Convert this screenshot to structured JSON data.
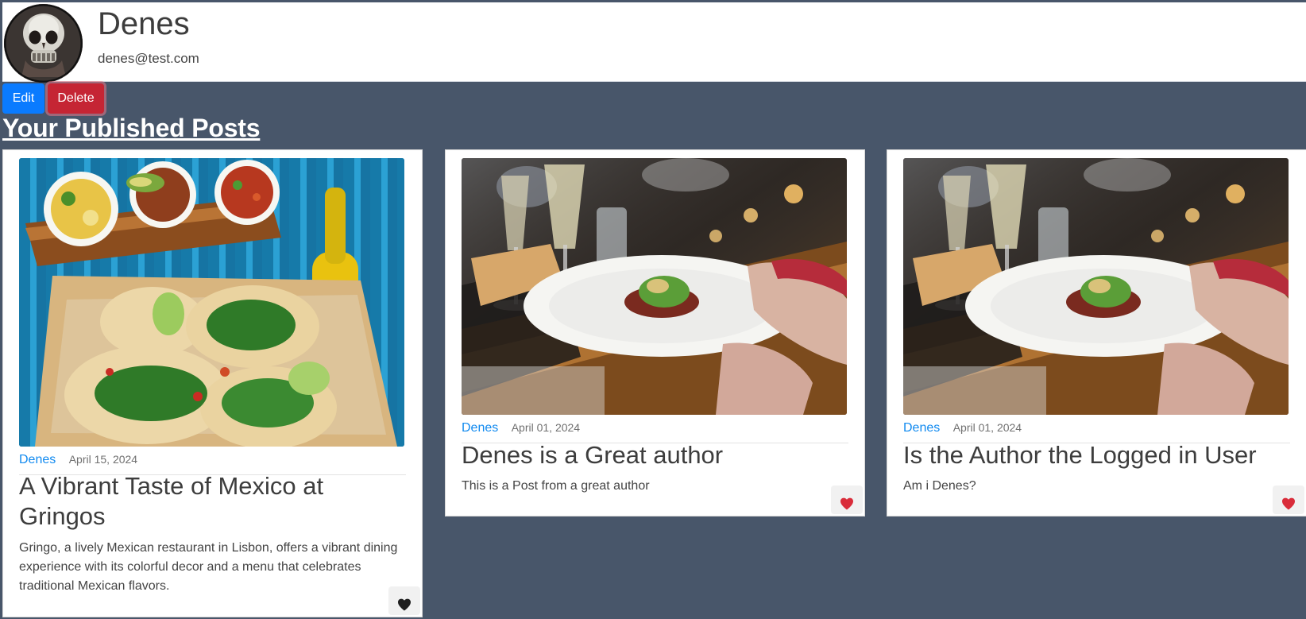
{
  "profile": {
    "name": "Denes",
    "email": "denes@test.com",
    "avatar_icon": "skull-avatar"
  },
  "actions": {
    "edit_label": "Edit",
    "delete_label": "Delete"
  },
  "section": {
    "title": "Your Published Posts"
  },
  "posts": [
    {
      "author": "Denes",
      "date": "April 15, 2024",
      "title": "A Vibrant Taste of Mexico at Gringos",
      "excerpt": "Gringo, a lively Mexican restaurant in Lisbon, offers a vibrant dining experience with its colorful decor and a menu that celebrates traditional Mexican flavors.",
      "image_desc": "tacos with salsa bowls and soda bottle",
      "liked": false,
      "like_icon": "heart-icon",
      "like_color": "#1f1f1f"
    },
    {
      "author": "Denes",
      "date": "April 01, 2024",
      "title": "Denes is a Great author",
      "excerpt": "This is a Post from a great author",
      "image_desc": "restaurant table with wine glasses and plated dish",
      "liked": true,
      "like_icon": "heart-icon",
      "like_color": "#d92c3a"
    },
    {
      "author": "Denes",
      "date": "April 01, 2024",
      "title": "Is the Author the Logged in User",
      "excerpt": "Am i Denes?",
      "image_desc": "restaurant table with wine glasses and plated dish",
      "liked": true,
      "like_icon": "heart-icon",
      "like_color": "#d92c3a"
    }
  ],
  "colors": {
    "page_background": "#48566a",
    "primary": "#0a7bff",
    "danger": "#c52534",
    "link": "#118af0"
  }
}
